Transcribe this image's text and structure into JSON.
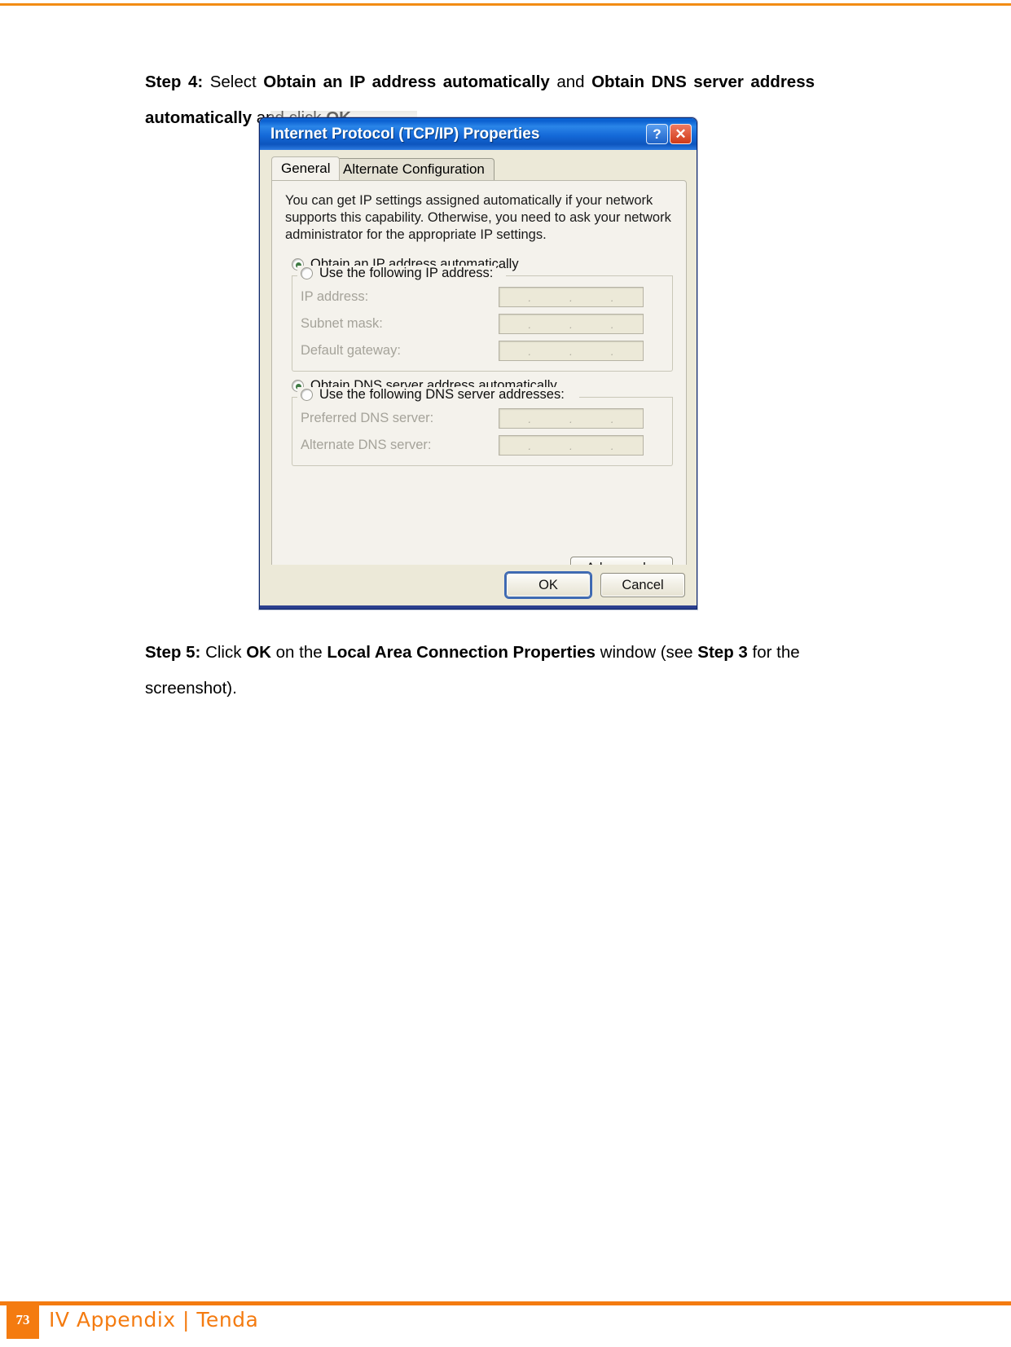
{
  "page": {
    "footer_page_number": "73",
    "footer_text": "IV Appendix | Tenda"
  },
  "step4": {
    "label": "Step 4:",
    "t1": "Select",
    "b1": "Obtain an IP address automatically",
    "t2": "and",
    "b2": "Obtain DNS server address automatically",
    "t3": "and click",
    "b3": "OK",
    "t4": "."
  },
  "step5": {
    "label": "Step 5:",
    "t1": "Click",
    "b1": "OK",
    "t2": "on the",
    "b2": "Local Area Connection Properties",
    "t3": "window (see",
    "b3": "Step 3",
    "t4": "for the screenshot)."
  },
  "dialog": {
    "title": "Internet Protocol (TCP/IP) Properties",
    "help_button": "?",
    "close_button": "✕",
    "tabs": [
      {
        "label": "General",
        "active": true
      },
      {
        "label": "Alternate Configuration",
        "active": false
      }
    ],
    "description": "You can get IP settings assigned automatically if your network supports this capability. Otherwise, you need to ask your network administrator for the appropriate IP settings.",
    "ip_section": {
      "auto_radio_label": "Obtain an IP address automatically",
      "auto_radio_selected": true,
      "manual_radio_label": "Use the following IP address:",
      "manual_radio_selected": false,
      "fields": [
        {
          "label": "IP address:",
          "value": ""
        },
        {
          "label": "Subnet mask:",
          "value": ""
        },
        {
          "label": "Default gateway:",
          "value": ""
        }
      ]
    },
    "dns_section": {
      "auto_radio_label": "Obtain DNS server address automatically",
      "auto_radio_selected": true,
      "manual_radio_label": "Use the following DNS server addresses:",
      "manual_radio_selected": false,
      "fields": [
        {
          "label": "Preferred DNS server:",
          "value": ""
        },
        {
          "label": "Alternate DNS server:",
          "value": ""
        }
      ]
    },
    "advanced_button": "Advanced...",
    "ok_button": "OK",
    "cancel_button": "Cancel",
    "colors": {
      "titlebar_blue": "#0a5fd0",
      "dialog_face": "#ece9d8",
      "panel_face": "#f4f2ec",
      "radio_dot_green": "#3e7a43",
      "brand_orange": "#f47b10"
    }
  }
}
